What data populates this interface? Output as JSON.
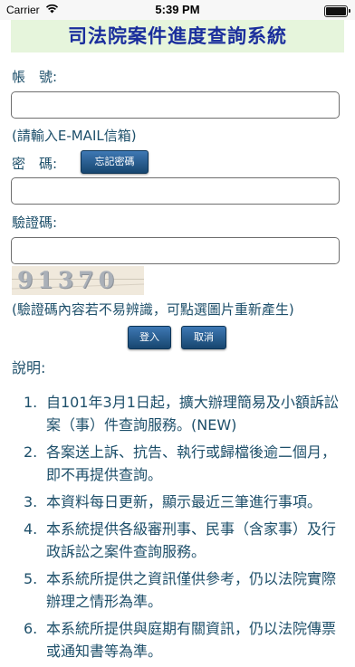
{
  "status_bar": {
    "carrier": "Carrier",
    "time": "5:39 PM"
  },
  "header": {
    "title": "司法院案件進度查詢系統"
  },
  "form": {
    "account_label": "帳　號:",
    "account_value": "",
    "account_hint": "(請輸入E-MAIL信箱)",
    "password_label": "密　碼:",
    "forgot_password_label": "忘記密碼",
    "password_value": "",
    "captcha_label": "驗證碼:",
    "captcha_value": "",
    "captcha_image_text": "91370",
    "captcha_hint": "(驗證碼內容若不易辨識，可點選圖片重新產生)",
    "login_label": "登入",
    "cancel_label": "取消"
  },
  "notes": {
    "heading": "說明:",
    "items": [
      {
        "num": "1.",
        "text": "自101年3月1日起，擴大辦理簡易及小額訴訟案（事）件查詢服務。(NEW)"
      },
      {
        "num": "2.",
        "text": "各案送上訴、抗告、執行或歸檔後逾二個月，即不再提供查詢。"
      },
      {
        "num": "3.",
        "text": "本資料每日更新，顯示最近三筆進行事項。"
      },
      {
        "num": "4.",
        "text": "本系統提供各級審刑事、民事（含家事）及行政訴訟之案件查詢服務。"
      },
      {
        "num": "5.",
        "text": "本系統所提供之資訊僅供參考，仍以法院實際辦理之情形為準。"
      },
      {
        "num": "6.",
        "text": "本系統所提供與庭期有關資訊，仍以法院傳票或通知書等為準。"
      }
    ]
  }
}
